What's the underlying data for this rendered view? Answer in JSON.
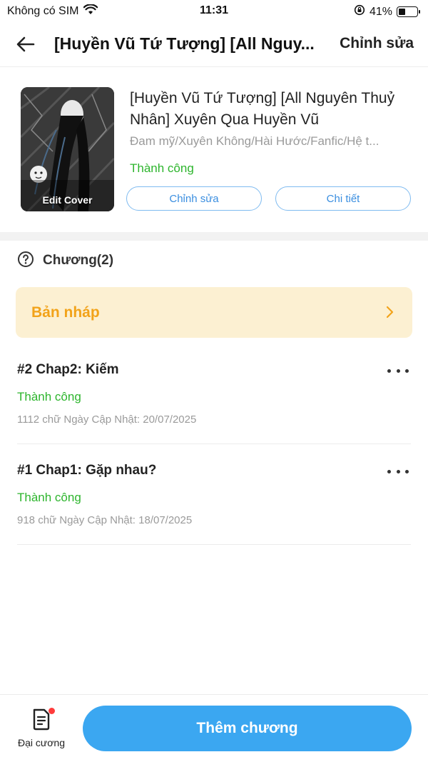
{
  "status_bar": {
    "carrier": "Không có SIM",
    "time": "11:31",
    "battery_percent": "41%",
    "battery_level": 0.41,
    "icons": [
      "wifi-icon",
      "orientation-lock-icon",
      "battery-icon"
    ]
  },
  "nav": {
    "title": "[Huyền Vũ Tứ Tượng] [All Nguy...",
    "edit_label": "Chỉnh sửa",
    "back_icon": "arrow-left-icon"
  },
  "book": {
    "cover_label": "Edit Cover",
    "title": "[Huyền Vũ Tứ Tượng] [All Nguyên Thuỷ Nhân] Xuyên Qua Huyền Vũ",
    "genres": "Đam mỹ/Xuyên Không/Hài Hước/Fanfic/Hệ t...",
    "status": "Thành công",
    "edit_button": "Chỉnh sửa",
    "detail_button": "Chi tiết"
  },
  "chapters": {
    "header": "Chương(2)",
    "help_icon": "question-circle-icon",
    "draft_label": "Bản nháp",
    "items": [
      {
        "title": "#2 Chap2: Kiếm",
        "status": "Thành công",
        "meta": "1112 chữ Ngày Cập Nhật: 20/07/2025"
      },
      {
        "title": "#1 Chap1: Gặp nhau?",
        "status": "Thành công",
        "meta": "918 chữ Ngày Cập Nhật: 18/07/2025"
      }
    ]
  },
  "bottom": {
    "outline_label": "Đại cương",
    "add_chapter": "Thêm chương"
  },
  "colors": {
    "accent_blue": "#3ba7f1",
    "success_green": "#2db52d",
    "draft_bg": "#fcf0d2",
    "draft_text": "#f2a31a"
  }
}
